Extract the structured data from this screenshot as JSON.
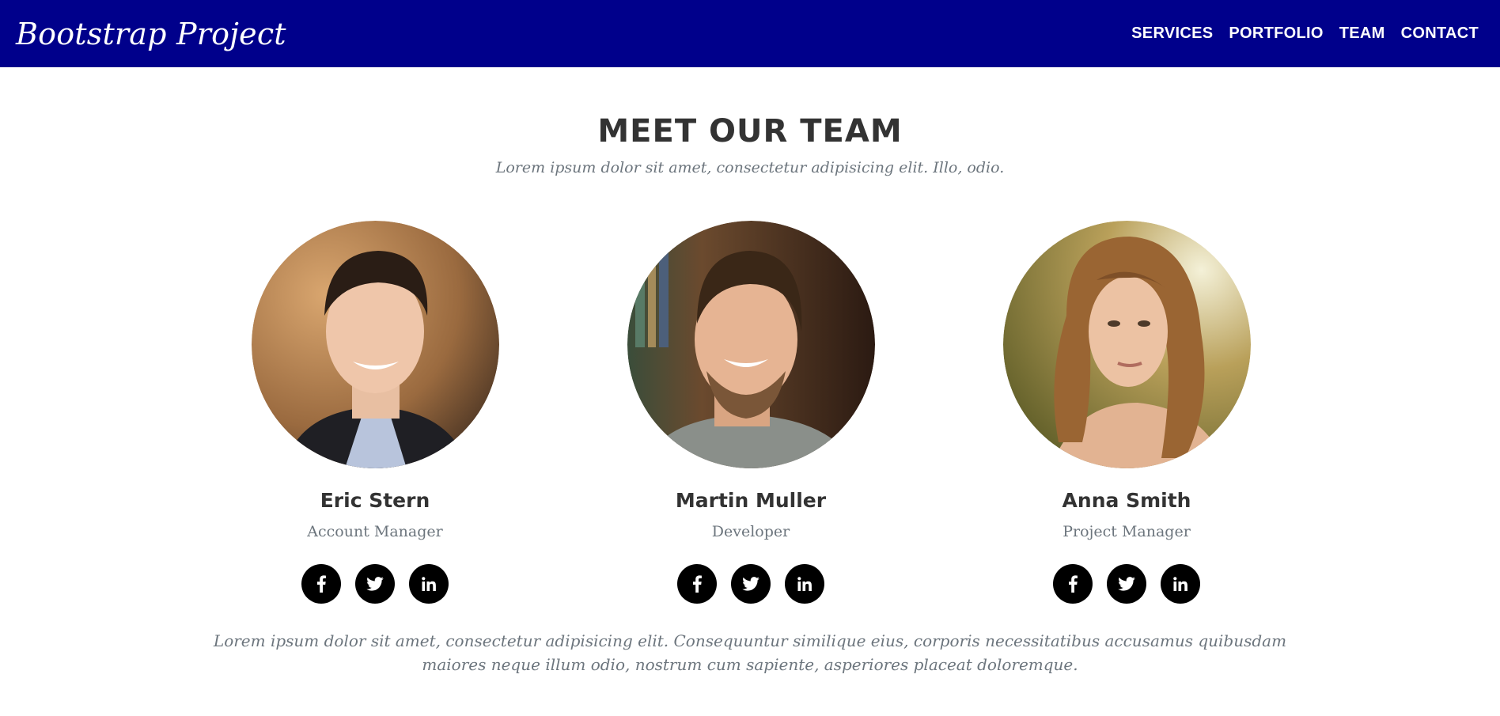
{
  "navbar": {
    "brand": "Bootstrap Project",
    "items": [
      {
        "label": "SERVICES"
      },
      {
        "label": "PORTFOLIO"
      },
      {
        "label": "TEAM"
      },
      {
        "label": "CONTACT"
      }
    ],
    "background_color": "#00008b"
  },
  "team": {
    "title": "MEET OUR TEAM",
    "subtitle": "Lorem ipsum dolor sit amet, consectetur adipisicing elit. Illo, odio.",
    "members": [
      {
        "name": "Eric Stern",
        "role": "Account Manager"
      },
      {
        "name": "Martin Muller",
        "role": "Developer"
      },
      {
        "name": "Anna Smith",
        "role": "Project Manager"
      }
    ],
    "social_icons": [
      "facebook-icon",
      "twitter-icon",
      "linkedin-icon"
    ],
    "footer": "Lorem ipsum dolor sit amet, consectetur adipisicing elit. Consequuntur similique eius, corporis necessitatibus accusamus quibusdam maiores neque illum odio, nostrum cum sapiente, asperiores placeat doloremque."
  }
}
